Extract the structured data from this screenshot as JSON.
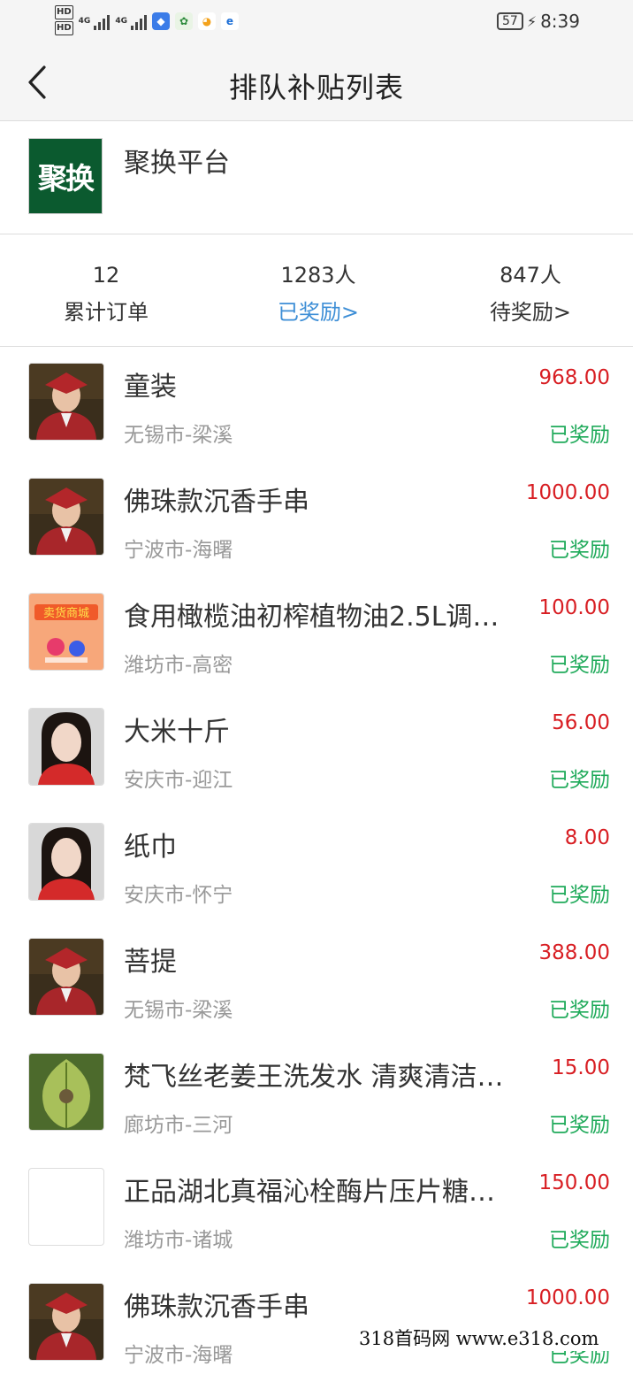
{
  "status_bar": {
    "hd1": "HD",
    "hd2": "HD",
    "net1": "4G",
    "net2": "4G",
    "battery": "57",
    "time": "8:39"
  },
  "header": {
    "title": "排队补贴列表",
    "back_icon": "chevron-left-icon"
  },
  "platform": {
    "logo_text": "聚换",
    "name": "聚换平台"
  },
  "stats": [
    {
      "value": "12",
      "label": "累计订单"
    },
    {
      "value": "1283人",
      "label": "已奖励>"
    },
    {
      "value": "847人",
      "label": "待奖励>"
    }
  ],
  "items": [
    {
      "title": "童装",
      "location": "无锡市-梁溪",
      "amount": "968.00",
      "status": "已奖励",
      "thumb": "graduate-child"
    },
    {
      "title": "佛珠款沉香手串",
      "location": "宁波市-海曙",
      "amount": "1000.00",
      "status": "已奖励",
      "thumb": "graduate-child"
    },
    {
      "title": "食用橄榄油初榨植物油2.5L调…",
      "location": "潍坊市-高密",
      "amount": "100.00",
      "status": "已奖励",
      "thumb": "mall-poster"
    },
    {
      "title": "大米十斤",
      "location": "安庆市-迎江",
      "amount": "56.00",
      "status": "已奖励",
      "thumb": "woman-portrait"
    },
    {
      "title": "纸巾",
      "location": "安庆市-怀宁",
      "amount": "8.00",
      "status": "已奖励",
      "thumb": "woman-portrait"
    },
    {
      "title": "菩提",
      "location": "无锡市-梁溪",
      "amount": "388.00",
      "status": "已奖励",
      "thumb": "graduate-child"
    },
    {
      "title": "梵飞丝老姜王洗发水 清爽清洁…",
      "location": "廊坊市-三河",
      "amount": "15.00",
      "status": "已奖励",
      "thumb": "leaf"
    },
    {
      "title": "正品湖北真福沁栓酶片压片糖…",
      "location": "潍坊市-诸城",
      "amount": "150.00",
      "status": "已奖励",
      "thumb": "blank"
    },
    {
      "title": "佛珠款沉香手串",
      "location": "宁波市-海曙",
      "amount": "1000.00",
      "status": "已奖励",
      "thumb": "graduate-child"
    }
  ],
  "watermark": "318首码网  www.e318.com",
  "colors": {
    "amount": "#d81e23",
    "status": "#1faa5a",
    "link": "#3d8ed6",
    "logo_bg": "#0b5a2f"
  }
}
